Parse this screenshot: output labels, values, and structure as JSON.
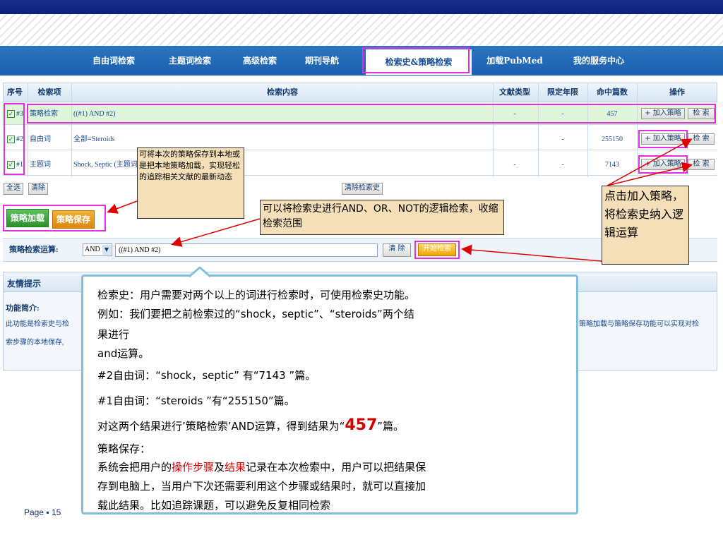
{
  "nav": {
    "items": [
      "自由词检索",
      "主题词检索",
      "高级检索",
      "期刊导航"
    ],
    "active": "检索史&策略检索",
    "right_items": [
      "加载PubMed",
      "我的服务中心"
    ]
  },
  "table": {
    "headers": [
      "序号",
      "检索项",
      "检索内容",
      "文献类型",
      "限定年限",
      "命中篇数",
      "操作"
    ],
    "rows": [
      {
        "idx": "#3",
        "field": "策略检索",
        "content": "((#1) AND #2)",
        "doctype": "-",
        "years": "-",
        "hits": "457",
        "add": "+ 加入策略",
        "search": "检 索"
      },
      {
        "idx": "#2",
        "field": "自由词",
        "content": "全部=Steroids",
        "doctype": "",
        "years": "-",
        "hits": "255150",
        "add": "+ 加入策略",
        "search": "检 索"
      },
      {
        "idx": "#1",
        "field": "主题词",
        "content": "Shock, Septic (主题词) (扩展)",
        "doctype": "-",
        "years": "-",
        "hits": "7143",
        "add": "+ 加入策略",
        "search": "检 索"
      }
    ]
  },
  "controls": {
    "select_all": "全选",
    "clear": "清除",
    "clear_history": "清除检索史",
    "load_strategy": "策略加载",
    "save_strategy": "策略保存",
    "op_label": "策略检索运算:",
    "op_value": "AND",
    "expr_value": "((#1) AND #2)",
    "clear_btn": "清 除",
    "start_btn": "开始检索"
  },
  "hint": {
    "title": "友情提示",
    "subtitle": "功能简介:",
    "line1_left": "此功能是检索史与检",
    "line1_right": "策略加载与策略保存功能可以实现对检",
    "line2_left": "索步骤的本地保存,"
  },
  "notes": {
    "save_note": "可将本次的策略保存到本地或是把本地策略加载，实现轻松的追踪相关文献的最新动态",
    "logic_note": "可以将检索史进行AND、OR、NOT的逻辑检索，收缩检索范围",
    "add_note": "点击加入策略，将检索史纳入逻辑运算"
  },
  "popup": {
    "l1": "检索史：用户需要对两个以上的词进行检索时，可使用检索史功能。",
    "l2": "例如：我们要把之前检索过的“shock，septic”、“steroids”两个结",
    "l3": "果进行",
    "l4": "and运算。",
    "l5": "#2自由词：“shock，septic” 有“7143 ”篇。",
    "l6": "#1自由词：“steroids ”有“255150”篇。",
    "l7a": "对这两个结果进行’策略检索’AND运算，得到结果为“",
    "l7b": "457",
    "l7c": "”篇。",
    "l8": "策略保存：",
    "l9a": "系统会把用户的",
    "l9b": "操作步骤",
    "l9c": "及",
    "l9d": "结果",
    "l9e": "记录在本次检索中，用户可以把结果保",
    "l10": "存到电脑上，当用户下次还需要利用这个步骤或结果时，就可以直接加",
    "l11": "载此结果。比如追踪课题，可以避免反复相同检索"
  },
  "footer": {
    "page": "Page ▪ 15"
  }
}
